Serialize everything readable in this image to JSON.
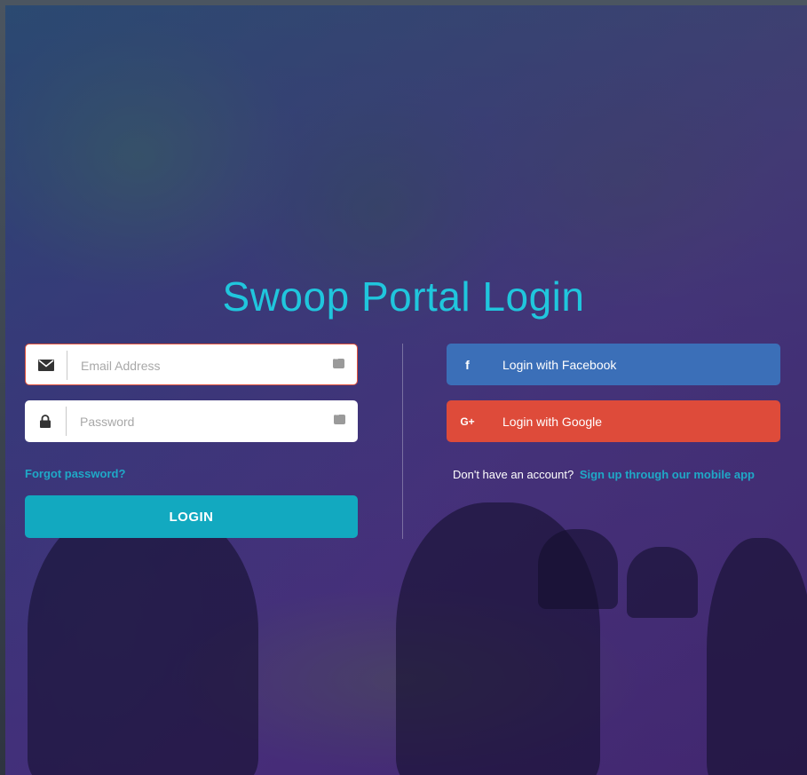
{
  "page": {
    "title": "Swoop Portal Login"
  },
  "form": {
    "email": {
      "placeholder": "Email Address",
      "value": "",
      "icon": "envelope-icon"
    },
    "password": {
      "placeholder": "Password",
      "value": "",
      "icon": "lock-icon"
    },
    "forgot_label": "Forgot password?",
    "login_label": "LOGIN"
  },
  "social": {
    "facebook": {
      "label": "Login with Facebook",
      "icon_glyph": "f",
      "color": "#3b6fb8"
    },
    "google": {
      "label": "Login with Google",
      "icon_glyph": "G+",
      "color": "#de4b3a"
    }
  },
  "signup": {
    "prompt": "Don't have an account?",
    "link_label": "Sign up through our mobile app"
  },
  "colors": {
    "accent": "#20c6dd",
    "login_button": "#12a9c0",
    "link": "#1fa9c7"
  }
}
